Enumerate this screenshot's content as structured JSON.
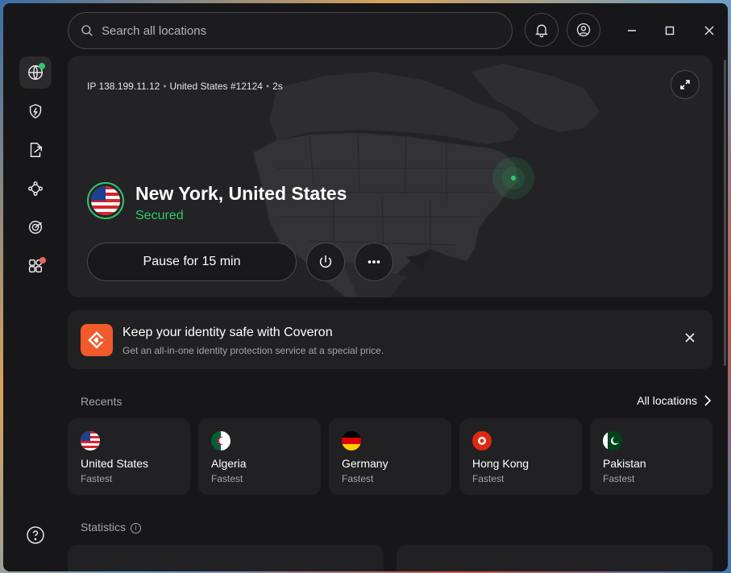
{
  "search": {
    "placeholder": "Search all locations"
  },
  "header": {
    "notifications_icon": "bell-icon",
    "account_icon": "user-icon"
  },
  "window_controls": [
    "minimize",
    "maximize",
    "close"
  ],
  "sidebar": {
    "items": [
      {
        "name": "globe",
        "icon": "globe-icon",
        "active": true,
        "badge_color": "#2ec96b"
      },
      {
        "name": "threat-protection",
        "icon": "shield-bolt-icon"
      },
      {
        "name": "file-share",
        "icon": "file-export-icon"
      },
      {
        "name": "meshnet",
        "icon": "mesh-icon"
      },
      {
        "name": "dark-web-monitor",
        "icon": "target-icon"
      },
      {
        "name": "apps",
        "icon": "apps-icon",
        "badge_color": "#f0655b"
      }
    ],
    "help_icon": "help-icon"
  },
  "connection": {
    "ip": "IP 138.199.11.12",
    "server": "United States #12124",
    "duration": "2s",
    "location": "New York, United States",
    "status": "Secured",
    "pause_label": "Pause for 15 min",
    "status_color": "#2ec96b"
  },
  "promo": {
    "title": "Keep your identity safe with Coveron",
    "subtitle": "Get an all-in-one identity protection service at a special price.",
    "accent": "#f15a2b"
  },
  "recents": {
    "label": "Recents",
    "all_locations": "All locations",
    "items": [
      {
        "name": "United States",
        "sub": "Fastest",
        "flag": "us"
      },
      {
        "name": "Algeria",
        "sub": "Fastest",
        "flag": "dz"
      },
      {
        "name": "Germany",
        "sub": "Fastest",
        "flag": "de"
      },
      {
        "name": "Hong Kong",
        "sub": "Fastest",
        "flag": "hk"
      },
      {
        "name": "Pakistan",
        "sub": "Fastest",
        "flag": "pk"
      }
    ]
  },
  "statistics": {
    "label": "Statistics"
  }
}
